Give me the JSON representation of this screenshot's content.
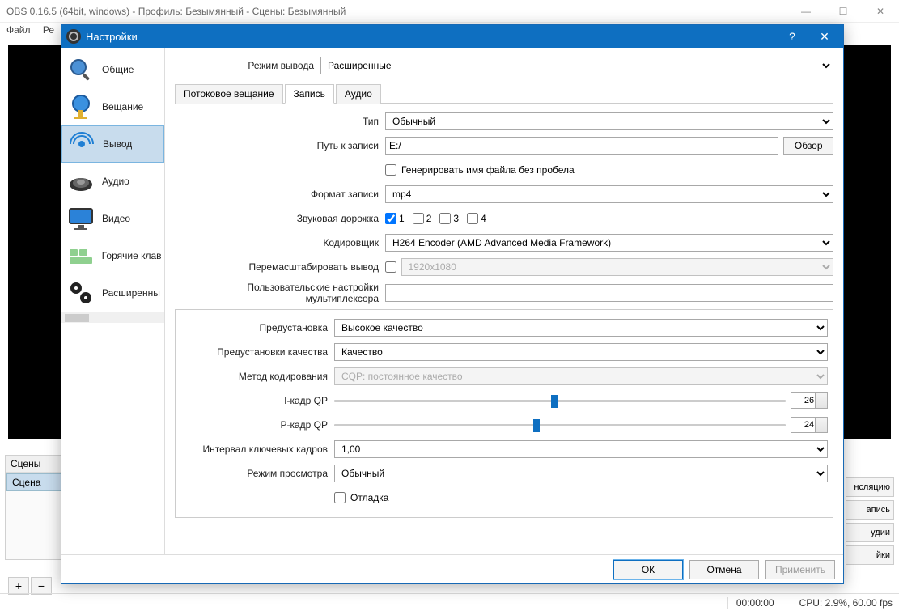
{
  "main_window": {
    "title": "OBS 0.16.5 (64bit, windows) - Профиль: Безымянный - Сцены: Безымянный",
    "menu_file": "Файл",
    "menu_p": "Ре",
    "scenes_header": "Сцены",
    "scene_item": "Сцена",
    "right_buttons": [
      "нсляцию",
      "апись",
      "удии",
      "йки"
    ],
    "status_time": "00:00:00",
    "status_cpu": "CPU: 2.9%, 60.00 fps"
  },
  "dialog": {
    "title": "Настройки",
    "sidebar": [
      {
        "label": "Общие"
      },
      {
        "label": "Вещание"
      },
      {
        "label": "Вывод"
      },
      {
        "label": "Аудио"
      },
      {
        "label": "Видео"
      },
      {
        "label": "Горячие клав"
      },
      {
        "label": "Расширенны"
      }
    ],
    "output_mode_label": "Режим вывода",
    "output_mode_value": "Расширенные",
    "tabs": {
      "stream": "Потоковое вещание",
      "record": "Запись",
      "audio": "Аудио"
    },
    "type_label": "Тип",
    "type_value": "Обычный",
    "record_path_label": "Путь к записи",
    "record_path_value": "E:/",
    "browse": "Обзор",
    "no_space_label": "Генерировать имя файла без пробела",
    "record_format_label": "Формат записи",
    "record_format_value": "mp4",
    "audio_track_label": "Звуковая дорожка",
    "tracks": [
      "1",
      "2",
      "3",
      "4"
    ],
    "encoder_label": "Кодировщик",
    "encoder_value": "H264 Encoder (AMD Advanced Media Framework)",
    "rescale_label": "Перемасштабировать вывод",
    "rescale_value": "1920x1080",
    "mux_label": "Пользовательские настройки мультиплексора",
    "preset_label": "Предустановка",
    "preset_value": "Высокое качество",
    "quality_preset_label": "Предустановки качества",
    "quality_preset_value": "Качество",
    "method_label": "Метод кодирования",
    "method_value": "CQP: постоянное качество",
    "iqp_label": "I-кадр QP",
    "iqp_value": "26",
    "pqp_label": "P-кадр QP",
    "pqp_value": "24",
    "keyint_label": "Интервал ключевых кадров",
    "keyint_value": "1,00",
    "viewmode_label": "Режим просмотра",
    "viewmode_value": "Обычный",
    "debug_label": "Отладка",
    "buttons": {
      "ok": "ОК",
      "cancel": "Отмена",
      "apply": "Применить"
    }
  }
}
